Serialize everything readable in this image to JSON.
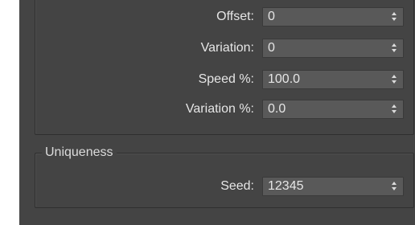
{
  "panel": {
    "fields": [
      {
        "label": "Offset:",
        "value": "0"
      },
      {
        "label": "Variation:",
        "value": "0"
      },
      {
        "label": "Speed %:",
        "value": "100.0"
      },
      {
        "label": "Variation %:",
        "value": "0.0"
      }
    ],
    "uniqueness": {
      "title": "Uniqueness",
      "seed_label": "Seed:",
      "seed_value": "12345"
    }
  },
  "colors": {
    "panel_bg": "#444444",
    "field_bg": "#595959",
    "text": "#e6e6e6"
  },
  "icons": {
    "spinner": "spinner-arrows-icon"
  }
}
